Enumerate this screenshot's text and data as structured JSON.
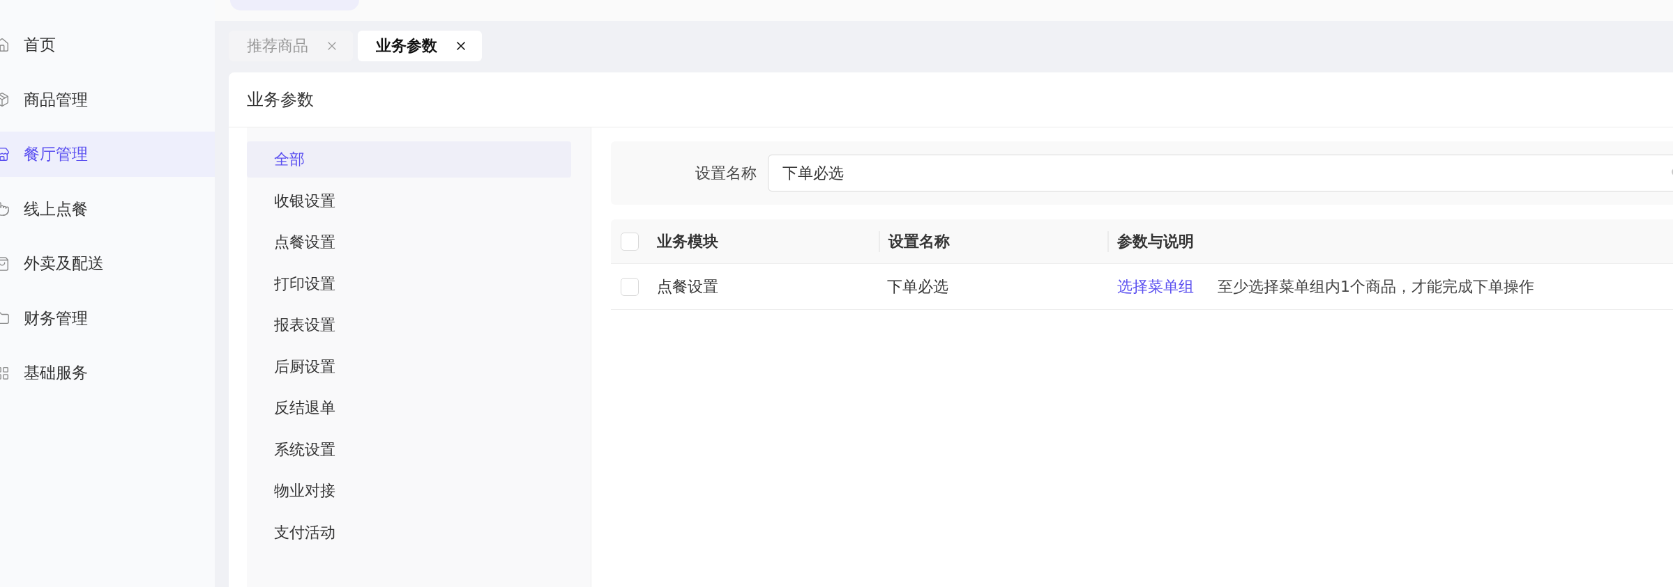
{
  "sidebar": {
    "items": [
      {
        "label": "首页",
        "selected": false
      },
      {
        "label": "商品管理",
        "selected": false
      },
      {
        "label": "餐厅管理",
        "selected": true
      },
      {
        "label": "线上点餐",
        "selected": false
      },
      {
        "label": "外卖及配送",
        "selected": false
      },
      {
        "label": "财务管理",
        "selected": false
      },
      {
        "label": "基础服务",
        "selected": false
      }
    ]
  },
  "tabs": [
    {
      "label": "推荐商品",
      "selected": false
    },
    {
      "label": "业务参数",
      "selected": true
    }
  ],
  "page_title": "业务参数",
  "categories": [
    {
      "label": "全部",
      "selected": true
    },
    {
      "label": "收银设置",
      "selected": false
    },
    {
      "label": "点餐设置",
      "selected": false
    },
    {
      "label": "打印设置",
      "selected": false
    },
    {
      "label": "报表设置",
      "selected": false
    },
    {
      "label": "后厨设置",
      "selected": false
    },
    {
      "label": "反结退单",
      "selected": false
    },
    {
      "label": "系统设置",
      "selected": false
    },
    {
      "label": "物业对接",
      "selected": false
    },
    {
      "label": "支付活动",
      "selected": false
    }
  ],
  "filter": {
    "label": "设置名称",
    "value": "下单必选"
  },
  "table": {
    "all_checked": false,
    "columns": [
      "业务模块",
      "设置名称",
      "参数与说明"
    ],
    "rows": [
      {
        "checked": false,
        "module": "点餐设置",
        "name": "下单必选",
        "link": "选择菜单组",
        "description": "至少选择菜单组内1个商品，才能完成下单操作"
      }
    ]
  }
}
